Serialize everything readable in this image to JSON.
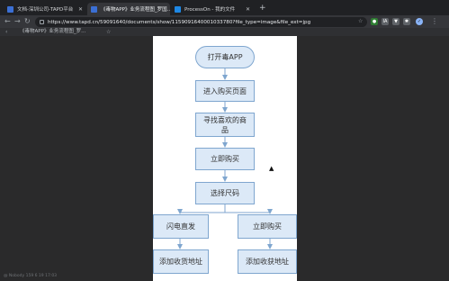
{
  "tabs": [
    {
      "title": "文档-深圳公司-TAPD平台",
      "active": false,
      "favicon_color": "#3b6fd4"
    },
    {
      "title": "《毒物APP》业务流程图_罗国...",
      "active": true,
      "favicon_color": "#3b6fd4"
    },
    {
      "title": "ProcessOn - 我的文件",
      "active": false,
      "favicon_color": "#1e88e5"
    }
  ],
  "toolbar": {
    "url": "https://www.tapd.cn/59091640/documents/show/1159091640001033780?file_type=image&file_ext=jpg",
    "extensions": [
      {
        "name": "green-extension-icon",
        "color": "#2e7d32",
        "glyph": "●"
      },
      {
        "name": "ia-extension-icon",
        "color": "#5f6368",
        "glyph": "IA"
      },
      {
        "name": "pin-extension-icon",
        "color": "#5f6368",
        "glyph": "▼"
      },
      {
        "name": "puzzle-extension-icon",
        "color": "#5f6368",
        "glyph": "✱"
      },
      {
        "name": "profile-icon",
        "color": "#8ab4f8",
        "glyph": "✓"
      }
    ]
  },
  "doc": {
    "title": "《毒物APP》业务流程图_罗..."
  },
  "flowchart": {
    "start": "打开毒APP",
    "step1": "进入购买页面",
    "step2": "寻找喜欢的商品",
    "step3": "立即购买",
    "step4": "选择尺码",
    "left_branch": "闪电直发",
    "right_branch": "立即购买",
    "left_next": "添加收货地址",
    "right_next": "添加收获地址"
  },
  "watermark": "@ Nobody 159 6 19  17:03"
}
